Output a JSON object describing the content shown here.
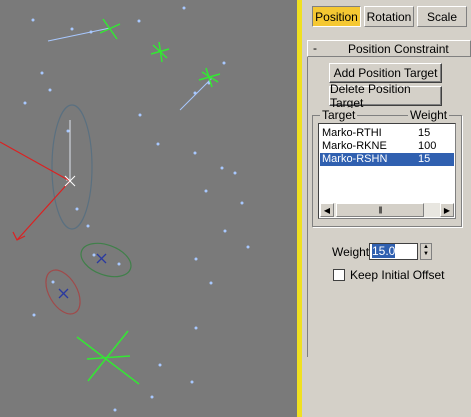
{
  "tabs": [
    {
      "label": "Position",
      "active": true
    },
    {
      "label": "Rotation",
      "active": false
    },
    {
      "label": "Scale",
      "active": false
    }
  ],
  "rollout": {
    "toggle": "-",
    "title": "Position Constraint"
  },
  "buttons": {
    "add_target": "Add Position Target",
    "delete_target": "Delete Position Target"
  },
  "list": {
    "header_target": "Target",
    "header_weight": "Weight",
    "rows": [
      {
        "name": "Marko-RTHI",
        "weight": "15",
        "selected": false
      },
      {
        "name": "Marko-RKNE",
        "weight": "100",
        "selected": false
      },
      {
        "name": "Marko-RSHN",
        "weight": "15",
        "selected": true
      }
    ],
    "scroll_thumb": "|||"
  },
  "weight": {
    "label": "Weight",
    "value": "15.0"
  },
  "keep_offset": {
    "label": "Keep Initial Offset",
    "checked": false
  },
  "colors": {
    "viewport": "#7a7a7a",
    "accent": "#f5c832",
    "selection": "#3060b0",
    "yellow_border": "#f0e020"
  }
}
